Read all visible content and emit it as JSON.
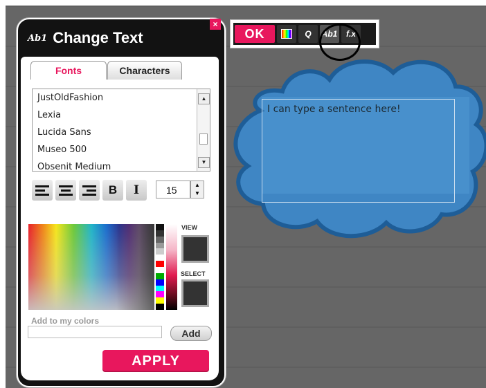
{
  "toolbar": {
    "ok_label": "OK",
    "buttons": [
      {
        "name": "color-swatch-icon"
      },
      {
        "name": "shape-icon",
        "label": "Q"
      },
      {
        "name": "text-style-icon",
        "label": "Ab1"
      },
      {
        "name": "effects-icon",
        "label": "f.x"
      }
    ],
    "accent": "#e8175d"
  },
  "canvas": {
    "textbox_text": "I can type a sentence here!",
    "cloud_fill": "#3f86c4",
    "cloud_stroke": "#1e5d97"
  },
  "dialog": {
    "title_icon": "Ab1",
    "title": "Change Text",
    "close_label": "×",
    "tabs": [
      {
        "label": "Fonts",
        "active": true
      },
      {
        "label": "Characters",
        "active": false
      }
    ],
    "fonts": [
      "JustOldFashion",
      "Lexia",
      "Lucida Sans",
      "Museo 500",
      "Obsenit Medium"
    ],
    "format_buttons": [
      "align-left",
      "align-center",
      "align-right",
      "B",
      "I"
    ],
    "font_size": "15",
    "view_label": "VIEW",
    "select_label": "SELECT",
    "add_colors_label": "Add to my colors",
    "add_button": "Add",
    "apply_button": "APPLY",
    "palette": [
      "#111111",
      "#333333",
      "#666666",
      "#999999",
      "#cccccc",
      "#ffffff",
      "#ff0000",
      "#ffffff",
      "#00aa00",
      "#0000ff",
      "#00ffff",
      "#ff00ff",
      "#ffff00",
      "#000000"
    ]
  }
}
